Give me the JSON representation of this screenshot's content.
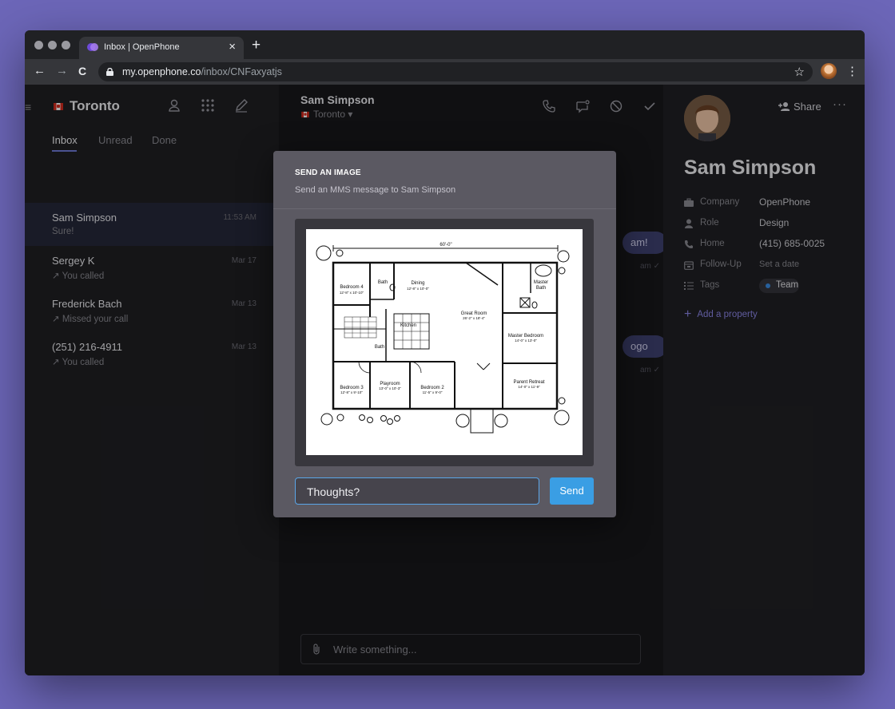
{
  "browser": {
    "tab_title": "Inbox | OpenPhone",
    "tab_close": "×",
    "new_tab": "+",
    "back": "←",
    "forward": "→",
    "reload": "C",
    "url_host": "my.openphone.co",
    "url_path": "/inbox/CNFaxyatjs",
    "star": "☆",
    "menu": "⋮"
  },
  "sidebar": {
    "menu_glyph": "≡",
    "workspace": "Toronto",
    "tabs": [
      "Inbox",
      "Unread",
      "Done"
    ],
    "conversations": [
      {
        "name": "Sam Simpson",
        "time": "11:53 AM",
        "preview": "Sure!"
      },
      {
        "name": "Sergey K",
        "time": "Mar 17",
        "preview": "↗ You called"
      },
      {
        "name": "Frederick Bach",
        "time": "Mar 13",
        "preview": "↗ Missed your call"
      },
      {
        "name": "(251) 216-4911",
        "time": "Mar 13",
        "preview": "↗ You called"
      }
    ]
  },
  "thread": {
    "contact_name": "Sam Simpson",
    "line": "Toronto ▾",
    "bubbles": [
      "am!",
      "ogo"
    ],
    "metas": [
      "am ✓",
      "am ✓"
    ],
    "composer_placeholder": "Write something..."
  },
  "contact": {
    "share_label": "Share",
    "more": "···",
    "name": "Sam Simpson",
    "properties": [
      {
        "label": "Company",
        "value": "OpenPhone"
      },
      {
        "label": "Role",
        "value": "Design"
      },
      {
        "label": "Home",
        "value": "(415) 685-0025"
      },
      {
        "label": "Follow-Up",
        "value": "Set a date"
      },
      {
        "label": "Tags",
        "value": ""
      }
    ],
    "tag": "Team",
    "add_property": "Add a property"
  },
  "modal": {
    "title": "SEND AN IMAGE",
    "subtitle": "Send an MMS message to Sam Simpson",
    "message_value": "Thoughts?",
    "send_label": "Send",
    "floorplan": {
      "dimension": "60'-0\"",
      "rooms": [
        {
          "name": "Bedroom 4",
          "size": "12'-8\" x 10'-10\""
        },
        {
          "name": "Bath",
          "size": ""
        },
        {
          "name": "Dining",
          "size": "12'-8\" x 10'-0\""
        },
        {
          "name": "Master",
          "size": "Bath"
        },
        {
          "name": "Great Room",
          "size": "26'-2\" x 18'-4\""
        },
        {
          "name": "Kitchen",
          "size": ""
        },
        {
          "name": "Master Bedroom",
          "size": "14'-0\" x 13'-0\""
        },
        {
          "name": "Bath",
          "size": ""
        },
        {
          "name": "Bedroom 3",
          "size": "12'-8\" x 9'-10\""
        },
        {
          "name": "Playroom",
          "size": "13'-0\" x 10'-3\""
        },
        {
          "name": "Bedroom 2",
          "size": "11'-5\" x 9'-0\""
        },
        {
          "name": "Parent Retreat",
          "size": "14'-0\" x 11'-9\""
        }
      ]
    }
  },
  "colors": {
    "background": "#6c66b8",
    "accent": "#3a9ee4",
    "link": "#8c86e8",
    "selected_row": "#26283a"
  }
}
